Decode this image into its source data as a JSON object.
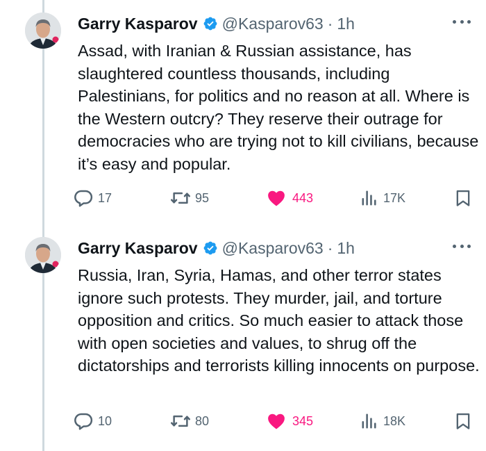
{
  "tweets": [
    {
      "author": {
        "name": "Garry Kasparov",
        "handle": "@Kasparov63",
        "verified": true,
        "avatar": "avatar-photo"
      },
      "separator": "·",
      "time": "1h",
      "text": "Assad, with Iranian & Russian assistance, has slaughtered countless thousands, including Palestinians, for politics and no reason at all. Where is the Western outcry? They reserve their outrage for democracies who are trying not to kill civilians, because it’s easy and popular.",
      "stats": {
        "replies": "17",
        "reposts": "95",
        "likes": "443",
        "views": "17K"
      },
      "liked": true
    },
    {
      "author": {
        "name": "Garry Kasparov",
        "handle": "@Kasparov63",
        "verified": true,
        "avatar": "avatar-photo"
      },
      "separator": "·",
      "time": "1h",
      "text": "Russia, Iran, Syria, Hamas, and other terror states ignore such protests. They murder, jail, and torture opposition and critics. So much easier to attack those with open societies and values, to shrug off the dictatorships and terrorists killing innocents on purpose.",
      "stats": {
        "replies": "10",
        "reposts": "80",
        "likes": "345",
        "views": "18K"
      },
      "liked": true
    }
  ],
  "colors": {
    "text": "#0f1419",
    "secondary": "#536471",
    "like": "#f91880",
    "verified": "#1d9bf0",
    "thread_line": "#cfd9de"
  },
  "icons": [
    "reply-icon",
    "repost-icon",
    "like-icon",
    "views-icon",
    "bookmark-icon",
    "more-icon",
    "verified-icon"
  ]
}
